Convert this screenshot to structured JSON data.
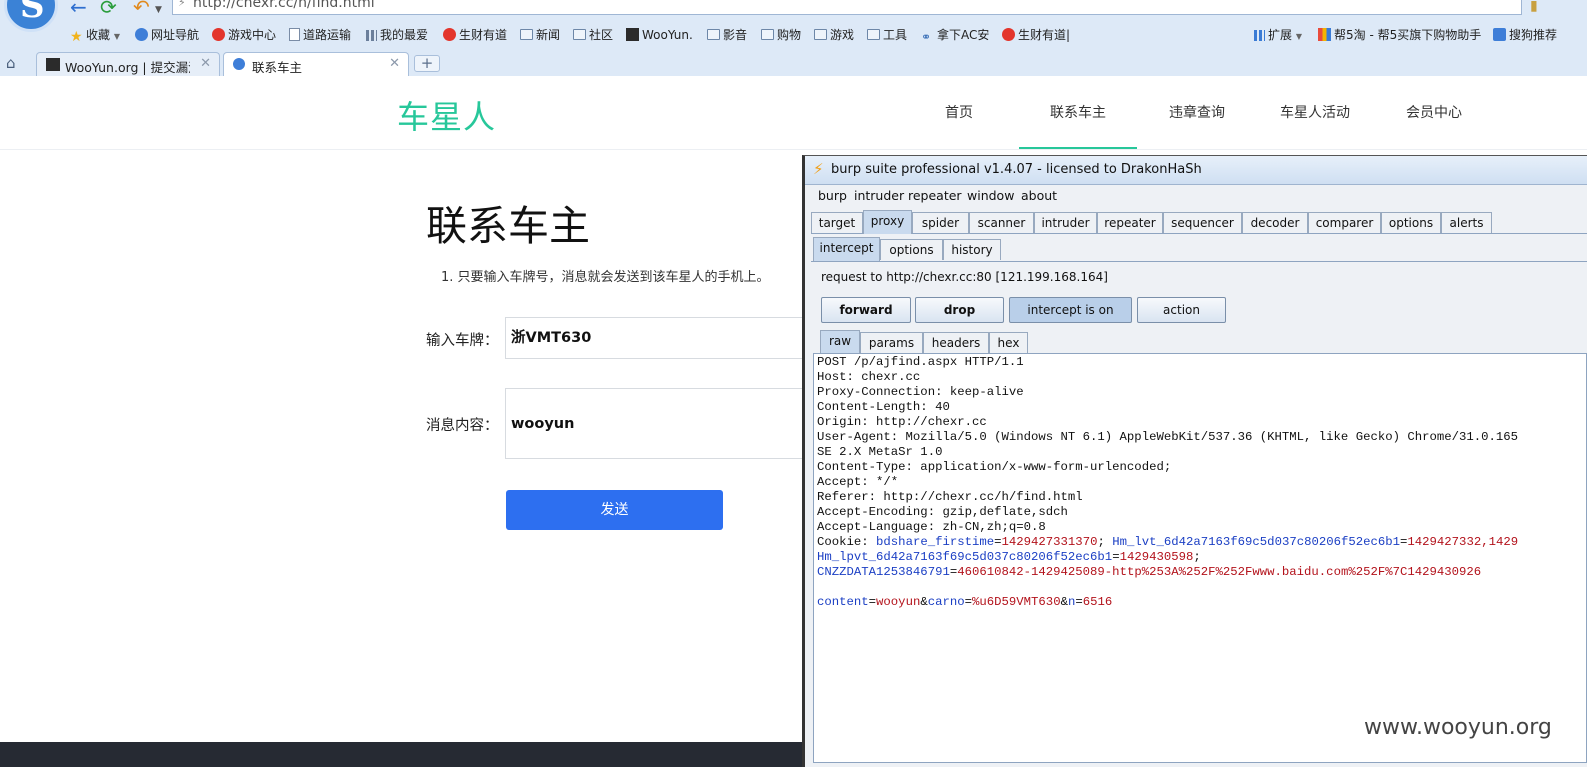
{
  "browser": {
    "address_url": "http://chexr.cc/h/find.html",
    "bookmarks": [
      {
        "label": "收藏",
        "icon": "star-icon"
      },
      {
        "label": "网址导航",
        "icon": "globe-icon"
      },
      {
        "label": "游戏中心",
        "icon": "game-icon"
      },
      {
        "label": "道路运输",
        "icon": "document-icon"
      },
      {
        "label": "我的最爱",
        "icon": "grid-icon"
      },
      {
        "label": "生财有道",
        "icon": "red-logo-icon"
      },
      {
        "label": "新闻",
        "icon": "folder-icon"
      },
      {
        "label": "社区",
        "icon": "folder-icon"
      },
      {
        "label": "WooYun.",
        "icon": "wooyun-icon"
      },
      {
        "label": "影音",
        "icon": "folder-icon"
      },
      {
        "label": "购物",
        "icon": "folder-icon"
      },
      {
        "label": "游戏",
        "icon": "folder-icon"
      },
      {
        "label": "工具",
        "icon": "folder-icon"
      },
      {
        "label": "拿下AC安",
        "icon": "link-icon"
      },
      {
        "label": "生财有道|",
        "icon": "red-logo-icon"
      }
    ],
    "extensions_label": "扩展",
    "bang5_label": "帮5淘 - 帮5买旗下购物助手",
    "sougou_label": "搜狗推荐",
    "tabs": [
      {
        "label": "WooYun.org | 提交漏洞"
      },
      {
        "label": "联系车主"
      }
    ]
  },
  "site": {
    "logo": "车星人",
    "nav": [
      "首页",
      "联系车主",
      "违章查询",
      "车星人活动",
      "会员中心"
    ],
    "page_title": "联系车主",
    "note": "1. 只要输入车牌号，消息就会发送到该车星人的手机上。",
    "plate_label": "输入车牌：",
    "plate_value": "浙VMT630",
    "message_label": "消息内容：",
    "message_value": "wooyun",
    "send_label": "发送"
  },
  "burp": {
    "title": "burp suite professional v1.4.07 - licensed to DrakonHaSh",
    "menu": [
      "burp",
      "intruder",
      "repeater",
      "window",
      "about"
    ],
    "tabs": [
      "target",
      "proxy",
      "spider",
      "scanner",
      "intruder",
      "repeater",
      "sequencer",
      "decoder",
      "comparer",
      "options",
      "alerts"
    ],
    "proxy_tabs": [
      "intercept",
      "options",
      "history"
    ],
    "request_line": "request to http://chexr.cc:80  [121.199.168.164]",
    "buttons": {
      "forward": "forward",
      "drop": "drop",
      "intercept": "intercept is on",
      "action": "action"
    },
    "view_tabs": [
      "raw",
      "params",
      "headers",
      "hex"
    ],
    "request": {
      "l1": "POST /p/ajfind.aspx HTTP/1.1",
      "l2": "Host: chexr.cc",
      "l3": "Proxy-Connection: keep-alive",
      "l4": "Content-Length: 40",
      "l5": "Origin: http://chexr.cc",
      "l6": "User-Agent: Mozilla/5.0 (Windows NT 6.1) AppleWebKit/537.36 (KHTML, like Gecko) Chrome/31.0.165",
      "l7": "SE 2.X MetaSr 1.0",
      "l8": "Content-Type: application/x-www-form-urlencoded;",
      "l9": "Accept: */*",
      "l10": "Referer: http://chexr.cc/h/find.html",
      "l11": "Accept-Encoding: gzip,deflate,sdch",
      "l12": "Accept-Language: zh-CN,zh;q=0.8",
      "cookie_prefix": "Cookie: ",
      "c1_key": "bdshare_firstime",
      "c1_val": "1429427331370",
      "c2_key": "Hm_lvt_6d42a7163f69c5d037c80206f52ec6b1",
      "c2_val": "1429427332,1429",
      "c3_key": "Hm_lpvt_6d42a7163f69c5d037c80206f52ec6b1",
      "c3_val": "1429430598",
      "c4_key": "CNZZDATA1253846791",
      "c4_val": "460610842-1429425089-http%253A%252F%252Fwww.baidu.com%252F%7C1429430926",
      "p1_key": "content",
      "p1_val": "wooyun",
      "p2_key": "carno",
      "p2_val": "%u6D59VMT630",
      "p3_key": "n",
      "p3_val": "6516"
    }
  },
  "watermark": "www.wooyun.org"
}
